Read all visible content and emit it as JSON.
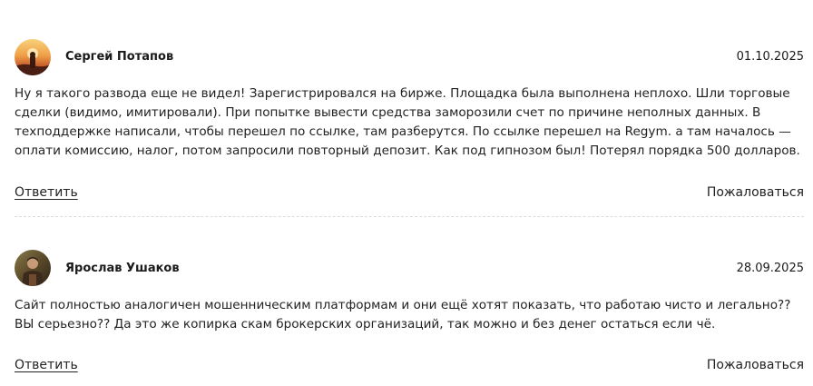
{
  "comments": [
    {
      "author": "Сергей Потапов",
      "date": "01.10.2025",
      "avatar": "sunset-landscape-photo",
      "text": "Ну я такого развода еще не видел! Зарегистрировался на бирже. Площадка была выполнена неплохо. Шли торговые сделки (видимо, имитировали). При попытке вывести средства заморозили счет по причине неполных данных. В техподдержке написали, чтобы перешел по ссылке, там разберутся. По ссылке перешел на Regym. а там началось — оплати комиссию, налог, потом запросили повторный депозит. Как под гипнозом был! Потерял порядка 500 долларов.",
      "reply_label": "Ответить",
      "complain_label": "Пожаловаться"
    },
    {
      "author": "Ярослав Ушаков",
      "date": "28.09.2025",
      "avatar": "person-outdoors-photo",
      "text": "Сайт полностью аналогичен мошенническим платформам и они ещё хотят показать, что работаю чисто и легально?? ВЫ серьезно?? Да это же копирка скам брокерских организаций, так можно и без денег остаться если чё.",
      "reply_label": "Ответить",
      "complain_label": "Пожаловаться"
    }
  ],
  "colors": {
    "text": "#222222",
    "divider": "#dcdcdc",
    "background": "#ffffff"
  }
}
